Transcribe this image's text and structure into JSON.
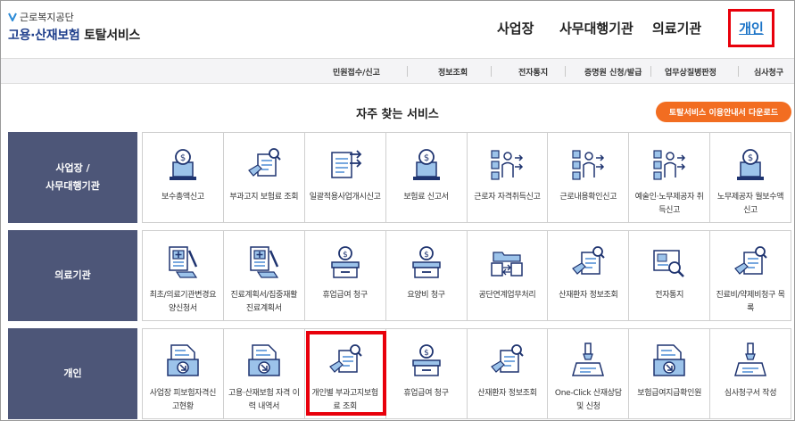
{
  "header": {
    "org": "근로복지공단",
    "title_blue": "고용·산재보험",
    "title_dark": " 토탈서비스",
    "nav": [
      "사업장",
      "사무대행기관",
      "의료기관"
    ],
    "nav_active": "개인"
  },
  "subnav": [
    "민원접수/신고",
    "정보조회",
    "전자통지",
    "증명원 신청/발급",
    "업무상질병판정",
    "심사청구"
  ],
  "section_title": "자주 찾는 서비스",
  "guide_button": "토탈서비스 이용안내서 다운로드",
  "categories": [
    {
      "label": "사업장 /\n사무대행기관",
      "items": [
        {
          "label": "보수총액신고",
          "icon": "coin-monitor-icon"
        },
        {
          "label": "부과고지 보험료 조회",
          "icon": "document-search-icon"
        },
        {
          "label": "일괄적용사업개시신고",
          "icon": "document-arrow-icon"
        },
        {
          "label": "보험료 신고서",
          "icon": "coin-monitor-icon"
        },
        {
          "label": "근로자 자격취득신고",
          "icon": "people-grid-icon"
        },
        {
          "label": "근로내용확인신고",
          "icon": "people-grid-icon"
        },
        {
          "label": "예술인·노무제공자 취득신고",
          "icon": "people-grid-icon"
        },
        {
          "label": "노무제공자 월보수액 신고",
          "icon": "coin-monitor-icon"
        }
      ]
    },
    {
      "label": "의료기관",
      "items": [
        {
          "label": "최초/의료기관변경요양신청서",
          "icon": "medical-document-icon"
        },
        {
          "label": "진료계획서/집중재활진료계획서",
          "icon": "medical-document-icon"
        },
        {
          "label": "휴업급여 청구",
          "icon": "coin-box-icon"
        },
        {
          "label": "요양비 청구",
          "icon": "coin-box-icon"
        },
        {
          "label": "공단연계업무처리",
          "icon": "transfer-icon"
        },
        {
          "label": "산재환자 정보조회",
          "icon": "document-search-icon"
        },
        {
          "label": "전자통지",
          "icon": "notice-search-icon"
        },
        {
          "label": "진료비/약제비청구 목록",
          "icon": "document-search-icon"
        }
      ]
    },
    {
      "label": "개인",
      "items": [
        {
          "label": "사업장 피보험자격신고현황",
          "icon": "tray-arrow-icon"
        },
        {
          "label": "고용·산재보험 자격 이력 내역서",
          "icon": "tray-arrow-icon"
        },
        {
          "label": "개인별 부과고지보험료 조회",
          "icon": "document-search-icon"
        },
        {
          "label": "휴업급여 청구",
          "icon": "coin-box-icon"
        },
        {
          "label": "산재환자 정보조회",
          "icon": "document-search-icon"
        },
        {
          "label": "One-Click 산재상담 및 신청",
          "icon": "pen-document-icon"
        },
        {
          "label": "보험급여지급확인원",
          "icon": "tray-arrow-icon"
        },
        {
          "label": "심사청구서 작성",
          "icon": "pen-document-icon"
        }
      ]
    }
  ],
  "colors": {
    "brand_blue": "#1f3f8c",
    "category_bg": "#4d5678",
    "orange": "#f26d21",
    "highlight": "#e8000b",
    "link": "#1a73c7"
  }
}
